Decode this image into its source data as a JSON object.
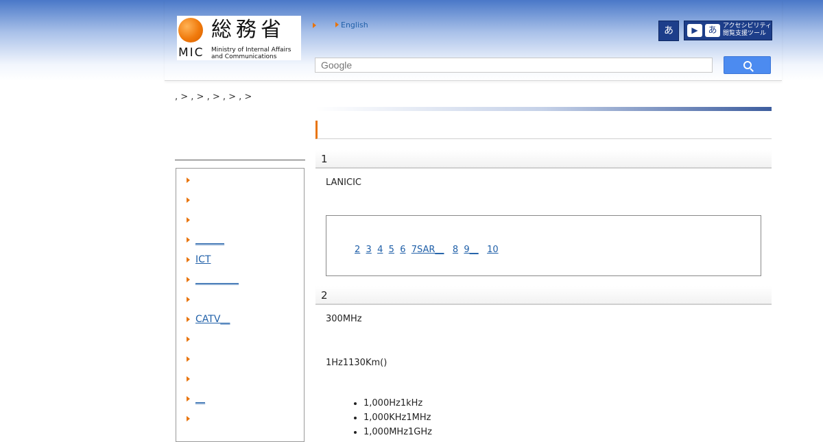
{
  "header": {
    "logo": {
      "kanji": "総務省",
      "abbr": "MIC",
      "sub_line1": "Ministry of Internal Affairs",
      "sub_line2": "and Communications"
    },
    "language_link": "English",
    "accessibility": {
      "small_label": "あ",
      "tool_line1": "アクセシビリティ",
      "tool_line2": "閲覧支援ツール"
    },
    "search": {
      "placeholder": "Google"
    }
  },
  "breadcrumb": ", > , > , > , > , >",
  "sidebar": {
    "items": [
      {
        "label": ""
      },
      {
        "label": ""
      },
      {
        "label": ""
      },
      {
        "label": "______"
      },
      {
        "label": "ICT"
      },
      {
        "label": "_________"
      },
      {
        "label": ""
      },
      {
        "label": "CATV__"
      },
      {
        "label": ""
      },
      {
        "label": ""
      },
      {
        "label": ""
      },
      {
        "label": "__"
      },
      {
        "label": ""
      }
    ]
  },
  "sections": [
    {
      "heading": "1",
      "text": "LANICIC",
      "links": [
        "2",
        "3",
        "4",
        "5",
        "6",
        "7SAR__",
        "8",
        "9__",
        "10"
      ]
    },
    {
      "heading": "2",
      "text1": "300MHz",
      "text2": "1Hz1130Km()",
      "list": [
        "1,000Hz1kHz",
        "1,000KHz1MHz",
        "1,000MHz1GHz"
      ]
    }
  ],
  "colors": {
    "accent": "#e8740c",
    "link": "#1f5fa8",
    "header": "#4a78c8",
    "search_button": "#4c8bf0",
    "accessibility_button": "#1d3e8a"
  }
}
